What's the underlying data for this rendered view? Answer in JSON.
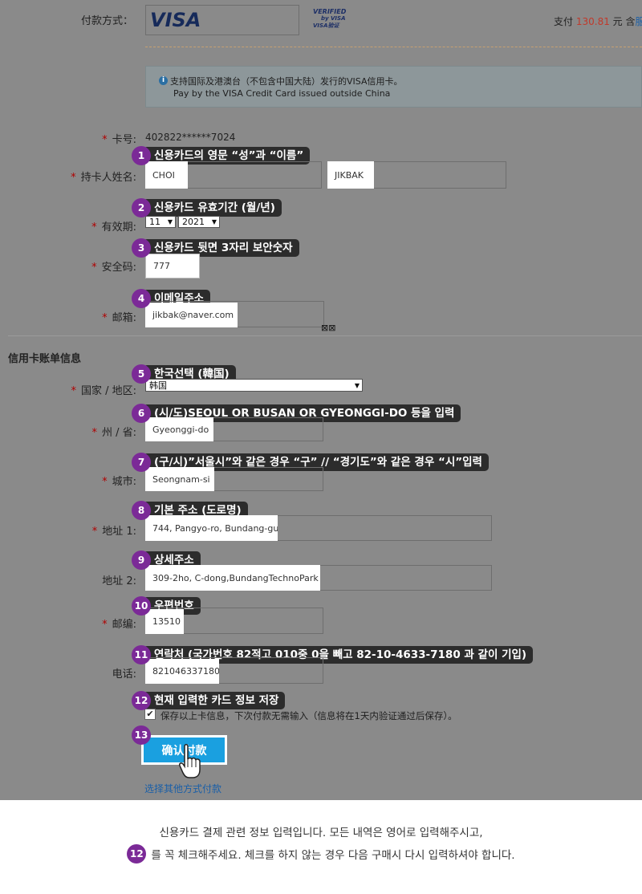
{
  "payment": {
    "method_label": "付款方式：",
    "visa_logo": "VISA",
    "verified_line1": "VERIFIED",
    "verified_line2": "by VISA",
    "verified_line3": "VISA验证",
    "pay_prefix": "支付",
    "pay_amount": "130.81",
    "pay_suffix": "元 含",
    "pay_more": "服",
    "notice_line1": "支持国际及港澳台（不包含中国大陆）发行的VISA信用卡。",
    "notice_line2": "Pay by the VISA Credit Card issued outside China"
  },
  "card": {
    "number_label": "卡号:",
    "number_value": "402822******7024",
    "holder_label": "持卡人姓名:",
    "last_name": "CHOI",
    "first_name": "JIKBAK",
    "expiry_label": "有效期:",
    "expiry_month": "11",
    "expiry_year": "2021",
    "cvv_label": "安全码:",
    "cvv_value": "777",
    "email_label": "邮箱:",
    "email_value": "jikbak@naver.com",
    "email_suffix": "⊠⊠"
  },
  "billing": {
    "section_title": "信用卡账单信息",
    "country_label": "国家 / 地区:",
    "country_value": "韩国",
    "state_label": "州 / 省:",
    "state_value": "Gyeonggi-do",
    "city_label": "城市:",
    "city_value": "Seongnam-si",
    "address1_label": "地址 1:",
    "address1_value": "744, Pangyo-ro, Bundang-gu",
    "address2_label": "地址 2:",
    "address2_value": "309-2ho, C-dong,BundangTechnoPark",
    "zip_label": "邮编:",
    "zip_value": "13510",
    "phone_label": "电话:",
    "phone_value": "821046337180",
    "save_text": "保存以上卡信息，下次付款无需输入（信息将在1天内验证通过后保存）。",
    "confirm_button": "确认付款",
    "other_method_link": "选择其他方式付款"
  },
  "callouts": [
    {
      "num": "1",
      "text": "신용카드의 영문 “성”과 “이름”"
    },
    {
      "num": "2",
      "text": "신용카드 유효기간 (월/년)"
    },
    {
      "num": "3",
      "text": "신용카드 뒷면 3자리 보안숫자"
    },
    {
      "num": "4",
      "text": "이메일주소"
    },
    {
      "num": "5",
      "text": "한국선택 (韓国)"
    },
    {
      "num": "6",
      "text": "(시/도)SEOUL OR BUSAN OR GYEONGGI-DO 등을 입력"
    },
    {
      "num": "7",
      "text": "(구/시)”서울시”와 같은 경우 “구” // “경기도”와 같은 경우 “시”입력"
    },
    {
      "num": "8",
      "text": "기본 주소 (도로명)"
    },
    {
      "num": "9",
      "text": "상세주소"
    },
    {
      "num": "10",
      "text": "우편번호"
    },
    {
      "num": "11",
      "text": "연락처 (국가번호 82적고 010중 0을 빼고 82-10-4633-7180 과 같이 기입)"
    },
    {
      "num": "12",
      "text": "현재 입력한 카드 정보 저장"
    },
    {
      "num": "13",
      "text": ""
    }
  ],
  "footer": {
    "line1": "신용카드 결제 관련 정보 입력입니다. 모든 내역은 영어로 입력해주시고,",
    "badge": "12",
    "line2": "를 꼭 체크해주세요. 체크를 하지 않는 경우 다음 구매시 다시 입력하셔야 합니다."
  },
  "colors": {
    "callout_badge": "#7b2a97",
    "callout_bg": "#2c2c2c",
    "button_blue": "#1aa0e0",
    "amount_red": "#c0392b",
    "link_blue": "#1a5fa8"
  }
}
